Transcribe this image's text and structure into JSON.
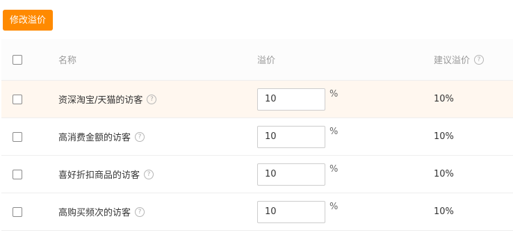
{
  "toolbar": {
    "modify_button_label": "修改溢价"
  },
  "table": {
    "headers": {
      "name": "名称",
      "premium": "溢价",
      "suggested_premium": "建议溢价"
    },
    "help_glyph": "?",
    "percent_unit": "%",
    "rows": [
      {
        "name": "资深淘宝/天猫的访客",
        "premium_value": "10",
        "suggested": "10%"
      },
      {
        "name": "高消费金额的访客",
        "premium_value": "10",
        "suggested": "10%"
      },
      {
        "name": "喜好折扣商品的访客",
        "premium_value": "10",
        "suggested": "10%"
      },
      {
        "name": "高购买频次的访客",
        "premium_value": "10",
        "suggested": "10%"
      }
    ]
  },
  "colors": {
    "primary_button": "#ff8a00",
    "highlight_row": "#fff7ef"
  },
  "icons": {
    "help": "question-circle-icon"
  }
}
